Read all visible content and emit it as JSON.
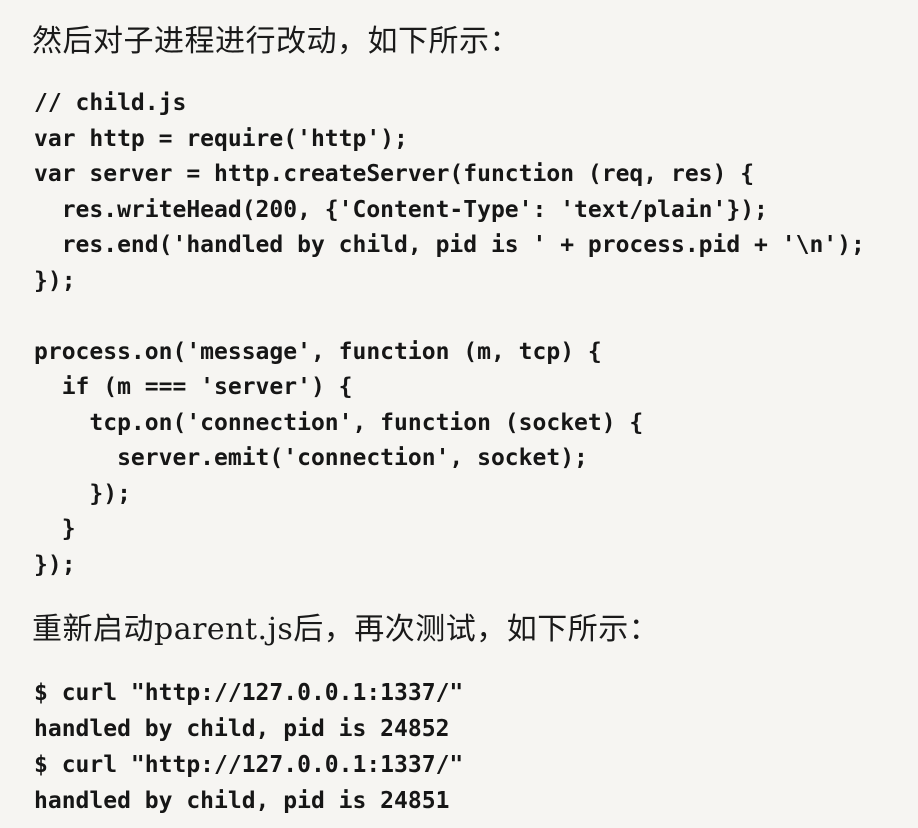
{
  "intro_text": "然后对子进程进行改动，如下所示：",
  "child_code_lines": [
    "// child.js",
    "var http = require('http');",
    "var server = http.createServer(function (req, res) {",
    "  res.writeHead(200, {'Content-Type': 'text/plain'});",
    "  res.end('handled by child, pid is ' + process.pid + '\\n');",
    "});",
    "",
    "process.on('message', function (m, tcp) {",
    "  if (m === 'server') {",
    "    tcp.on('connection', function (socket) {",
    "      server.emit('connection', socket);",
    "    });",
    "  }",
    "});"
  ],
  "restart_text": "重新启动parent.js后，再次测试，如下所示：",
  "curl_code_lines": [
    "$ curl \"http://127.0.0.1:1337/\"",
    "handled by child, pid is 24852",
    "$ curl \"http://127.0.0.1:1337/\"",
    "handled by child, pid is 24851"
  ]
}
